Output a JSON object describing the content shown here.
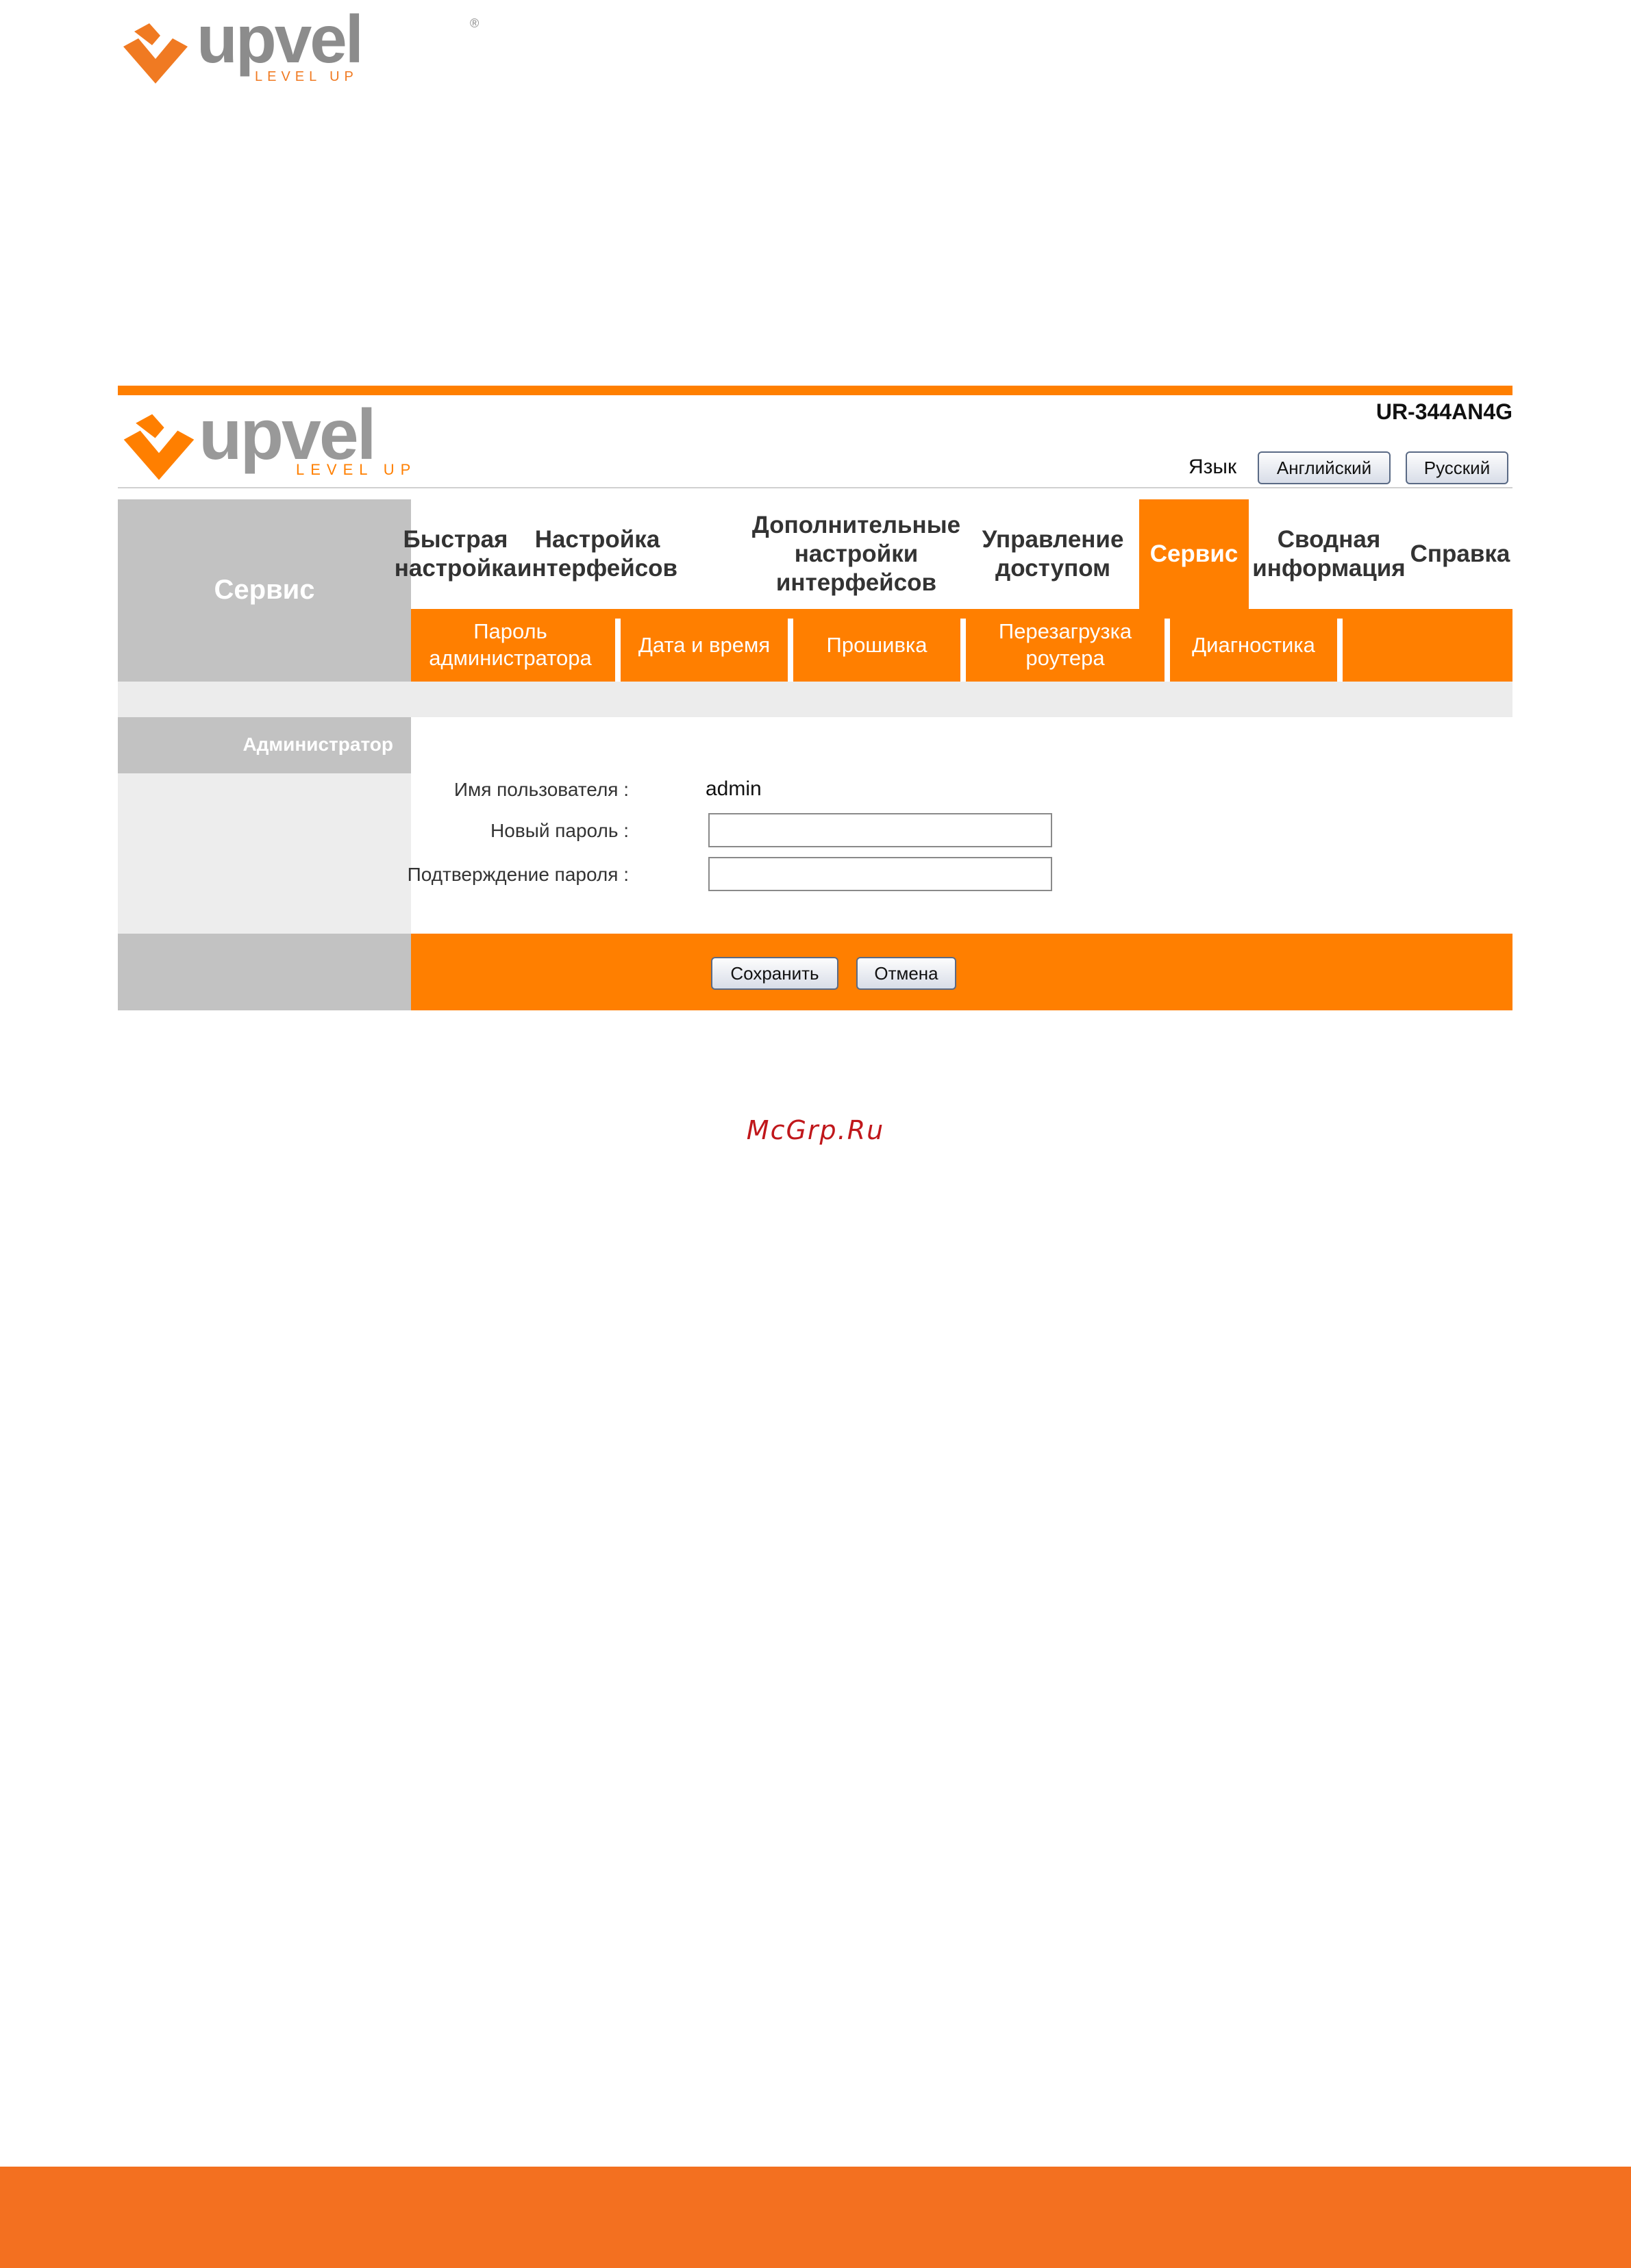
{
  "colors": {
    "accent": "#ff7f00",
    "page_footer": "#f37020",
    "panel_gray": "#c2c2c2",
    "watermark": "#c0171b"
  },
  "page_logo": {
    "brand": "upvel",
    "tagline": "LEVEL UP",
    "registered": "®"
  },
  "router_ui": {
    "brand": "upvel",
    "tagline": "LEVEL UP",
    "model": "UR-344AN4G",
    "language": {
      "label": "Язык",
      "english": "Английский",
      "russian": "Русский"
    },
    "section_title": "Сервис",
    "tabs": [
      {
        "label": "Быстрая\nнастройка"
      },
      {
        "label": "Настройка\nинтерфейсов"
      },
      {
        "label": "Дополнительные\nнастройки\nинтерфейсов"
      },
      {
        "label": "Управление\nдоступом"
      },
      {
        "label": "Сервис",
        "active": true
      },
      {
        "label": "Сводная\nинформация"
      },
      {
        "label": "Справка"
      }
    ],
    "subtabs": [
      {
        "label": "Пароль\nадминистратора"
      },
      {
        "label": "Дата и время"
      },
      {
        "label": "Прошивка"
      },
      {
        "label": "Перезагрузка\nроутера"
      },
      {
        "label": "Диагностика"
      }
    ],
    "section_label": "Администратор",
    "form": {
      "username_label": "Имя пользователя :",
      "username_value": "admin",
      "new_password_label": "Новый пароль :",
      "new_password_value": "",
      "confirm_password_label": "Подтверждение пароля :",
      "confirm_password_value": ""
    },
    "buttons": {
      "save": "Сохранить",
      "cancel": "Отмена"
    }
  },
  "watermark": "McGrp.Ru"
}
